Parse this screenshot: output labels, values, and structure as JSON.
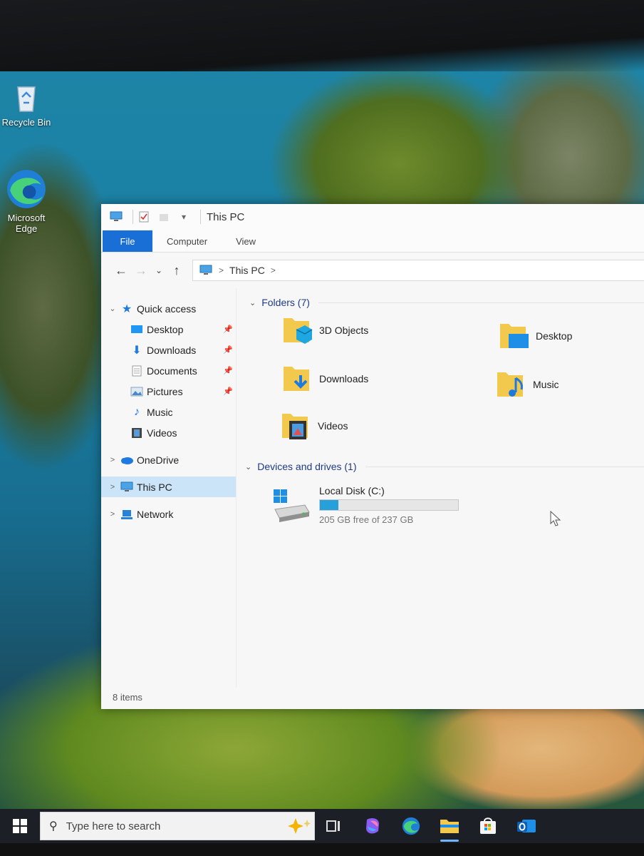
{
  "desktop": {
    "icons": [
      {
        "label": "Recycle Bin",
        "icon": "recycle-bin-icon"
      },
      {
        "label": "Microsoft Edge",
        "icon": "edge-icon"
      }
    ]
  },
  "window": {
    "title": "This PC",
    "ribbon_tabs": [
      "File",
      "Computer",
      "View"
    ],
    "address": {
      "crumbs": [
        "This PC"
      ]
    },
    "nav": {
      "quick_access": "Quick access",
      "pinned": [
        "Desktop",
        "Downloads",
        "Documents",
        "Pictures"
      ],
      "unpinned": [
        "Music",
        "Videos"
      ],
      "onedrive": "OneDrive",
      "this_pc": "This PC",
      "network": "Network"
    },
    "folders_header": "Folders (7)",
    "folders": [
      "3D Objects",
      "Desktop",
      "Downloads",
      "Music",
      "Videos"
    ],
    "devices_header": "Devices and drives (1)",
    "drive": {
      "name": "Local Disk (C:)",
      "free_text": "205 GB free of 237 GB",
      "used_fraction": 0.135
    },
    "status": "8 items"
  },
  "taskbar": {
    "search_placeholder": "Type here to search",
    "apps": [
      "task-view-icon",
      "copilot-icon",
      "edge-icon",
      "file-explorer-icon",
      "microsoft-store-icon",
      "outlook-icon"
    ]
  },
  "colors": {
    "accent": "#1a6fd6",
    "selection": "#cce4f7",
    "drive_bar": "#26a0da",
    "taskbar": "#1c2026"
  }
}
